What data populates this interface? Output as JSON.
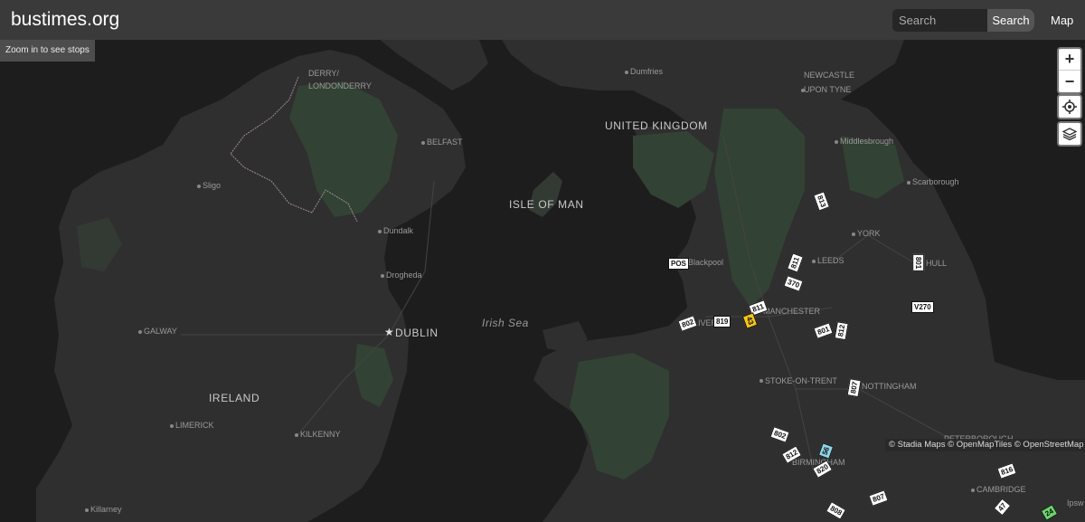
{
  "header": {
    "site_title": "bustimes.org",
    "search_placeholder": "Search",
    "search_button": "Search",
    "map_link": "Map"
  },
  "map": {
    "zoom_notice": "Zoom in to see stops",
    "attribution": "© Stadia Maps © OpenMapTiles © OpenStreetMap",
    "controls": {
      "zoom_in": "+",
      "zoom_out": "−",
      "locate_icon": "locate-icon",
      "layers_icon": "layers-icon"
    },
    "place_labels": {
      "derry": "DERRY/",
      "londonderry": "LONDONDERRY",
      "belfast": "BELFAST",
      "sligo": "Sligo",
      "dundalk": "Dundalk",
      "drogheda": "Drogheda",
      "dublin": "DUBLIN",
      "galway": "GALWAY",
      "ireland": "IRELAND",
      "limerick": "LIMERICK",
      "kilkenny": "KILKENNY",
      "killarney": "Killarney",
      "isle_of_man": "ISLE OF MAN",
      "irish_sea": "Irish Sea",
      "united_kingdom": "UNITED KINGDOM",
      "dumfries": "Dumfries",
      "newcastle": "NEWCASTLE",
      "upon_tyne": "UPON TYNE",
      "middlesbrough": "Middlesbrough",
      "scarborough": "Scarborough",
      "york": "YORK",
      "leeds": "LEEDS",
      "hull": "HULL",
      "blackpool": "Blackpool",
      "manchester": "MANCHESTER",
      "liverpool": "LIVERP",
      "stoke": "STOKE-ON-TRENT",
      "nottingham": "NOTTINGHAM",
      "peterborough": "PETERBOROUGH",
      "birmingham": "BIRMINGHAM",
      "cambridge": "CAMBRIDGE",
      "ipswich": "Ipsw"
    },
    "buses": [
      {
        "label": "813"
      },
      {
        "label": "811"
      },
      {
        "label": "370"
      },
      {
        "label": "801"
      },
      {
        "label": "V270"
      },
      {
        "label": "POS"
      },
      {
        "label": "811"
      },
      {
        "label": "43"
      },
      {
        "label": "819"
      },
      {
        "label": "802"
      },
      {
        "label": "801"
      },
      {
        "label": "812"
      },
      {
        "label": "807"
      },
      {
        "label": "802"
      },
      {
        "label": "56"
      },
      {
        "label": "812"
      },
      {
        "label": "820"
      },
      {
        "label": "807"
      },
      {
        "label": "808"
      },
      {
        "label": "47"
      },
      {
        "label": "24"
      },
      {
        "label": "816"
      }
    ]
  }
}
